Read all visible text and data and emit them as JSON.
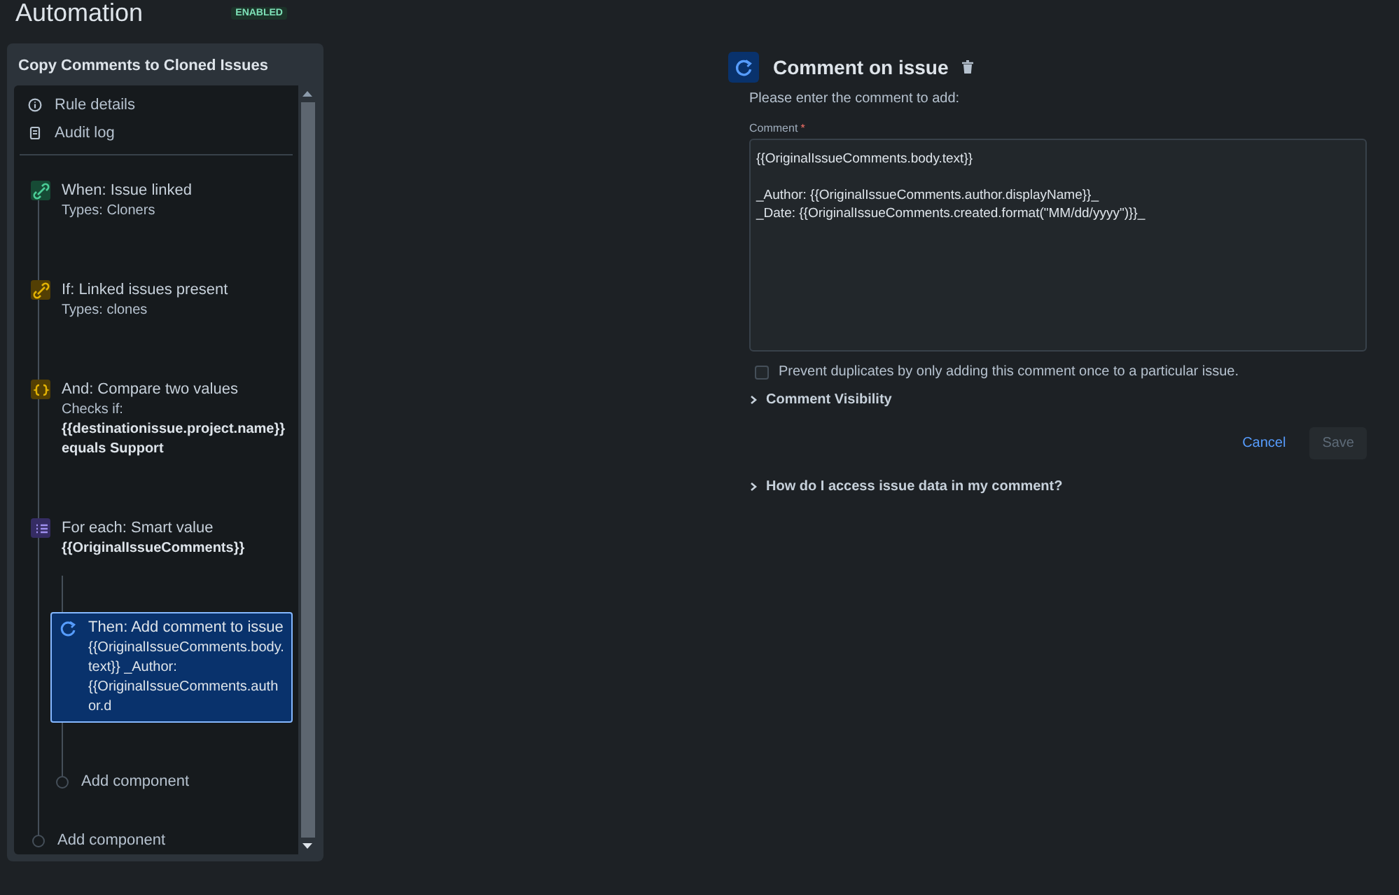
{
  "header": {
    "title": "Automation",
    "status": "ENABLED"
  },
  "rule": {
    "title": "Copy Comments to Cloned Issues",
    "links": [
      {
        "kind": "info",
        "label": "Rule details"
      },
      {
        "kind": "log",
        "label": "Audit log"
      }
    ],
    "steps": [
      {
        "kind": "trigger",
        "title": "When: Issue linked",
        "details": [
          {
            "text": "Types: Cloners",
            "bold": false
          }
        ],
        "selected": false
      },
      {
        "kind": "condition",
        "title": "If: Linked issues present",
        "details": [
          {
            "text": "Types: clones",
            "bold": false
          }
        ],
        "selected": false
      },
      {
        "kind": "compare",
        "title": "And: Compare two values",
        "details": [
          {
            "text": "Checks if:",
            "bold": false
          },
          {
            "text": "{{destinationissue.project.name}} equals Support",
            "bold": true
          }
        ],
        "selected": false
      },
      {
        "kind": "branch",
        "title": "For each: Smart value",
        "details": [
          {
            "text": "{{OriginalIssueComments}}",
            "bold": true
          }
        ],
        "selected": false,
        "children": [
          {
            "kind": "action",
            "title": "Then: Add comment to issue",
            "details": [
              {
                "text": "{{OriginalIssueComments.body.text}} _Author: {{OriginalIssueComments.author.d",
                "bold": false
              }
            ],
            "selected": true
          }
        ],
        "add_label": "Add component"
      }
    ],
    "add_label": "Add component"
  },
  "editor": {
    "title": "Comment on issue",
    "prompt": "Please enter the comment to add:",
    "field_label": "Comment",
    "required_mark": "*",
    "value": "{{OriginalIssueComments.body.text}}\n\n_Author: {{OriginalIssueComments.author.displayName}}_\n_Date: {{OriginalIssueComments.created.format(\"MM/dd/yyyy\")}}_",
    "checkbox": {
      "label": "Prevent duplicates by only adding this comment once to a particular issue.",
      "checked": false
    },
    "sections": [
      {
        "label": "Comment Visibility",
        "expanded": false
      }
    ],
    "buttons": [
      {
        "kind": "link",
        "label": "Cancel",
        "disabled": false
      },
      {
        "kind": "primary",
        "label": "Save",
        "disabled": true
      }
    ],
    "help": {
      "label": "How do I access issue data in my comment?",
      "expanded": false
    }
  }
}
